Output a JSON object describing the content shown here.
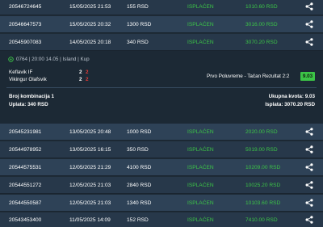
{
  "colors": {
    "background": "#1e2b36",
    "row": "#27384a",
    "row_alt": "#2e4257",
    "detail_bg": "#1c2935",
    "status_green": "#3cc447",
    "score_red": "#e53935"
  },
  "tickets_top": [
    {
      "id": "20546724645",
      "date": "15/05/2025 21:53",
      "amount": "155 RSD",
      "status": "ISPLAĆEN",
      "win": "1010.60 RSD",
      "icon": "share-icon"
    },
    {
      "id": "20546647573",
      "date": "15/05/2025 20:32",
      "amount": "1300 RSD",
      "status": "ISPLAĆEN",
      "win": "3016.00 RSD",
      "icon": "share-icon"
    },
    {
      "id": "20545907083",
      "date": "14/05/2025 20:18",
      "amount": "340 RSD",
      "status": "ISPLAĆEN",
      "win": "3070.20 RSD",
      "icon": "share-icon"
    }
  ],
  "detail": {
    "match_info": "0764 | 20:00 14.05 | Island | Kup",
    "home_team": "Keflavik IF",
    "away_team": "Vikingur Olafsvik",
    "home_score_a": "2",
    "home_score_b": "2",
    "away_score_a": "2",
    "away_score_b": "2",
    "bet": "Prvo Poluvreme - Tačan Rezultat 2:2",
    "odds": "9.03",
    "combinations": "Broj kombinacija 1",
    "stake": "Uplata: 340 RSD",
    "total_odds": "Ukupna kvota: 9.03",
    "payout": "Isplata: 3070.20 RSD"
  },
  "tickets_bottom": [
    {
      "id": "20545231981",
      "date": "13/05/2025 20:48",
      "amount": "1000 RSD",
      "status": "ISPLAĆEN",
      "win": "2020.00 RSD",
      "icon": "share-icon"
    },
    {
      "id": "20544978952",
      "date": "13/05/2025 16:15",
      "amount": "350 RSD",
      "status": "ISPLAĆEN",
      "win": "5019.00 RSD",
      "icon": "share-icon"
    },
    {
      "id": "20544575531",
      "date": "12/05/2025 21:29",
      "amount": "4100 RSD",
      "status": "ISPLAĆEN",
      "win": "10209.00 RSD",
      "icon": "share-icon"
    },
    {
      "id": "20544551272",
      "date": "12/05/2025 21:03",
      "amount": "2840 RSD",
      "status": "ISPLAĆEN",
      "win": "10025.20 RSD",
      "icon": "share-icon"
    },
    {
      "id": "20544550587",
      "date": "12/05/2025 21:03",
      "amount": "1340 RSD",
      "status": "ISPLAĆEN",
      "win": "10103.60 RSD",
      "icon": "share-icon"
    },
    {
      "id": "20543453400",
      "date": "11/05/2025 14:09",
      "amount": "152 RSD",
      "status": "ISPLAĆEN",
      "win": "7410.00 RSD",
      "icon": "share-icon"
    }
  ]
}
